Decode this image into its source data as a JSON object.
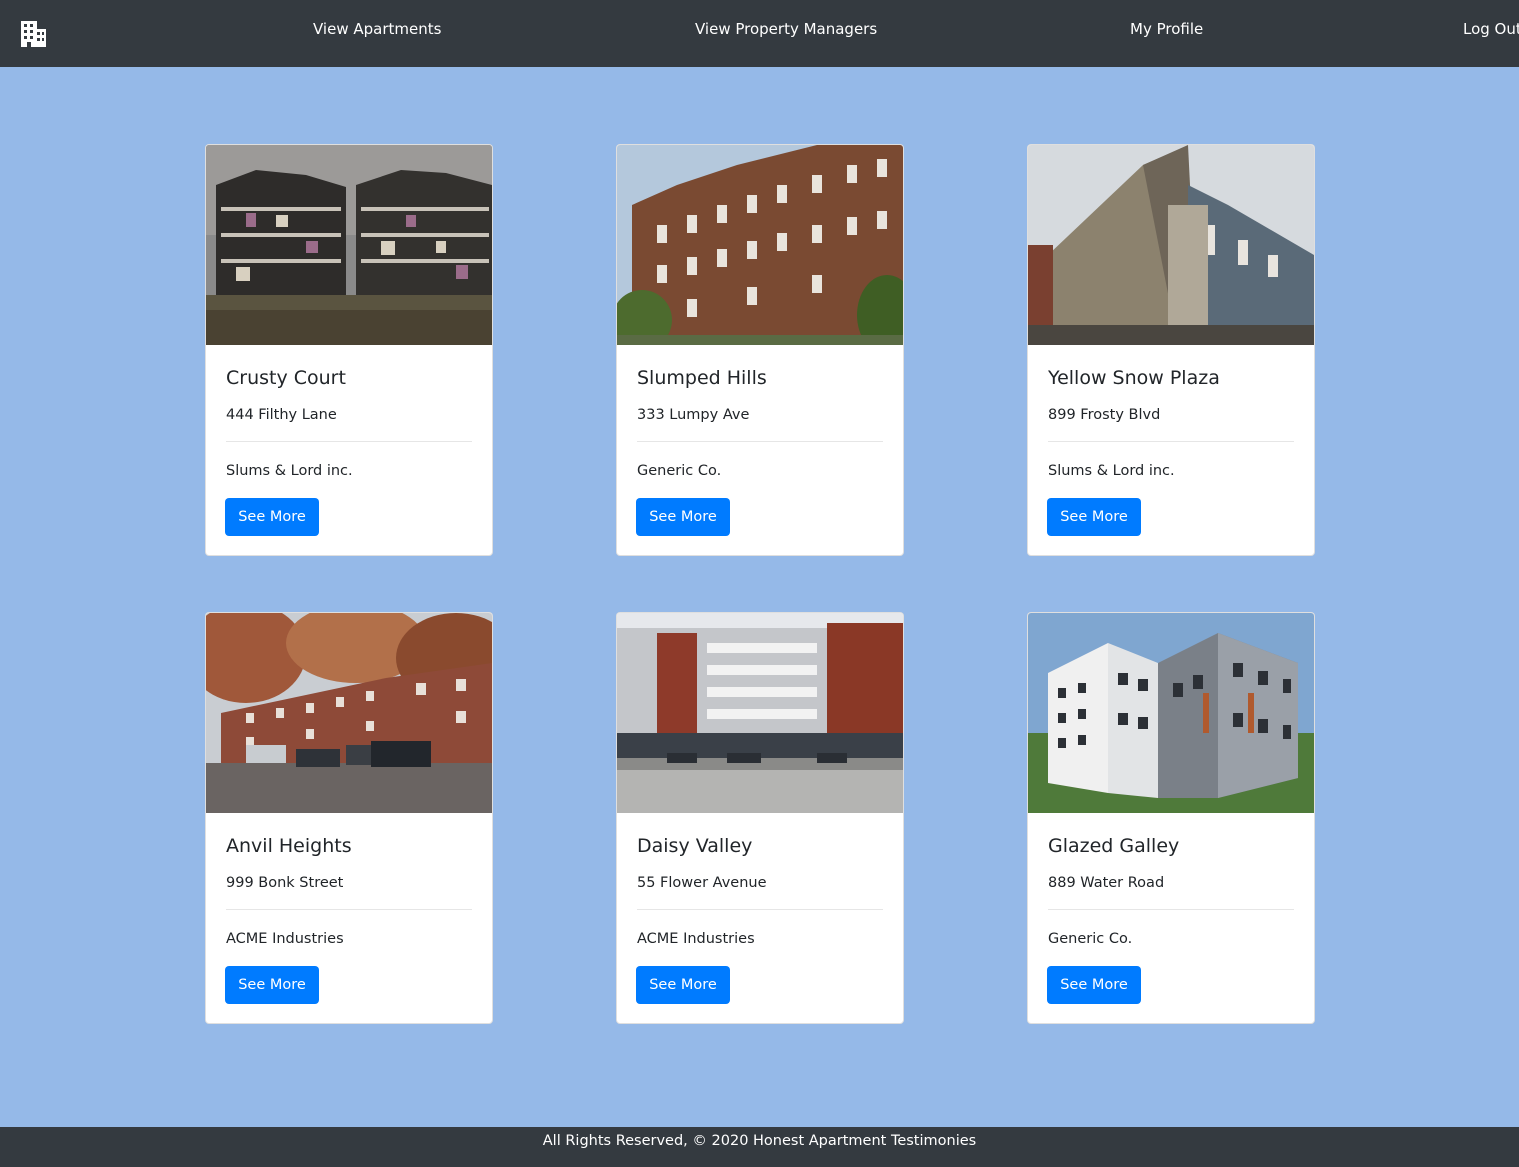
{
  "nav": {
    "brand_icon": "building-icon",
    "links": [
      {
        "label": "View Apartments"
      },
      {
        "label": "View Property Managers"
      },
      {
        "label": "My Profile"
      },
      {
        "label": "Log Out"
      }
    ]
  },
  "cards": [
    {
      "name": "Crusty Court",
      "address": "444 Filthy Lane",
      "manager": "Slums & Lord inc.",
      "button": "See More"
    },
    {
      "name": "Slumped Hills",
      "address": "333 Lumpy Ave",
      "manager": "Generic Co.",
      "button": "See More"
    },
    {
      "name": "Yellow Snow Plaza",
      "address": "899 Frosty Blvd",
      "manager": "Slums & Lord inc.",
      "button": "See More"
    },
    {
      "name": "Anvil Heights",
      "address": "999 Bonk Street",
      "manager": "ACME Industries",
      "button": "See More"
    },
    {
      "name": "Daisy Valley",
      "address": "55 Flower Avenue",
      "manager": "ACME Industries",
      "button": "See More"
    },
    {
      "name": "Glazed Galley",
      "address": "889 Water Road",
      "manager": "Generic Co.",
      "button": "See More"
    }
  ],
  "footer": {
    "text": "All Rights Reserved, © 2020 Honest Apartment Testimonies"
  },
  "colors": {
    "navbar": "#343a40",
    "page_bg": "#95b9e8",
    "button": "#007bff"
  }
}
